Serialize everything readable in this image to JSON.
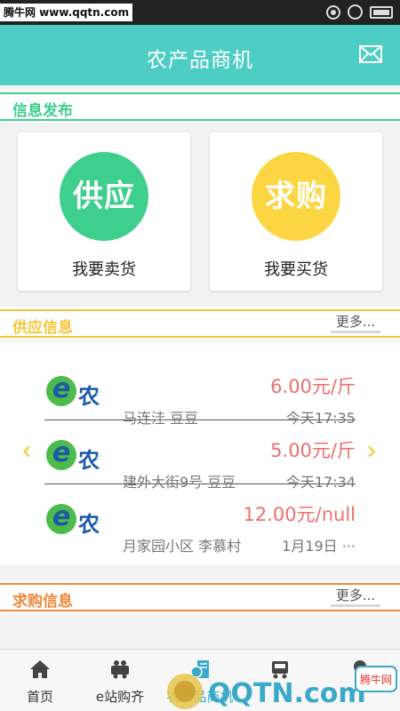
{
  "watermark": "腾牛网 www.qqtn.com",
  "header": {
    "title": "农产品商机"
  },
  "publish": {
    "title": "信息发布",
    "cards": [
      {
        "badge": "供应",
        "label": "我要卖货",
        "color": "#3ecf8e"
      },
      {
        "badge": "求购",
        "label": "我要买货",
        "color": "#fcd642"
      }
    ]
  },
  "supply": {
    "title": "供应信息",
    "more": "更多...",
    "items": [
      {
        "logo": "e农",
        "price": "6.00元/斤",
        "place": "马连洼   豆豆",
        "time": "今天17:35"
      },
      {
        "logo": "e农",
        "price": "5.00元/斤",
        "place": "建外大街9号   豆豆",
        "time": "今天17:34"
      },
      {
        "logo": "e农",
        "price": "12.00元/null",
        "place": "月家园小区   李慕村",
        "time": "1月19日 ···"
      }
    ]
  },
  "purchase": {
    "title": "求购信息",
    "more": "更多..."
  },
  "tabs": [
    {
      "label": "首页",
      "icon": "home-icon"
    },
    {
      "label": "e站购齐",
      "icon": "cart-icon"
    },
    {
      "label": "农产品商机",
      "icon": "business-icon",
      "active": true
    },
    {
      "label": "",
      "icon": "truck-icon"
    },
    {
      "label": "",
      "icon": "user-icon"
    }
  ],
  "corner_watermark": {
    "site": "QQTN.com",
    "badge": "腾牛网"
  },
  "colors": {
    "header": "#4ecdc4",
    "publish_accent": "#3ecf8e",
    "supply_accent": "#f5c73a",
    "purchase_accent": "#f0893b",
    "price": "#ef6f6c"
  }
}
